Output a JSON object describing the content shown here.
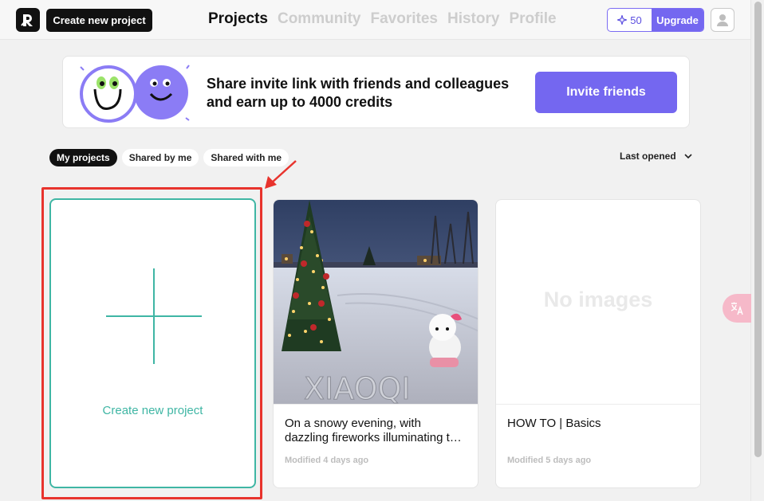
{
  "header": {
    "create_label": "Create new project",
    "nav": [
      {
        "label": "Projects",
        "active": true
      },
      {
        "label": "Community",
        "active": false
      },
      {
        "label": "Favorites",
        "active": false
      },
      {
        "label": "History",
        "active": false
      },
      {
        "label": "Profile",
        "active": false
      }
    ],
    "credits": "50",
    "upgrade_label": "Upgrade"
  },
  "banner": {
    "text": "Share invite link with friends and colleagues and earn up to 4000 credits",
    "button_label": "Invite friends"
  },
  "filters": {
    "chips": [
      {
        "label": "My projects",
        "active": true
      },
      {
        "label": "Shared by me",
        "active": false
      },
      {
        "label": "Shared with me",
        "active": false
      }
    ],
    "sort_label": "Last opened"
  },
  "projects": {
    "new_label": "Create new project",
    "cards": [
      {
        "title": "On a snowy evening, with dazzling fireworks illuminating the sky",
        "modified": "Modified 4 days ago",
        "has_image": true
      },
      {
        "title": "HOW TO | Basics",
        "modified": "Modified 5 days ago",
        "has_image": false,
        "placeholder": "No images"
      }
    ]
  },
  "colors": {
    "accent": "#7467f0",
    "teal": "#3fb6a4",
    "highlight": "#e8332d"
  }
}
